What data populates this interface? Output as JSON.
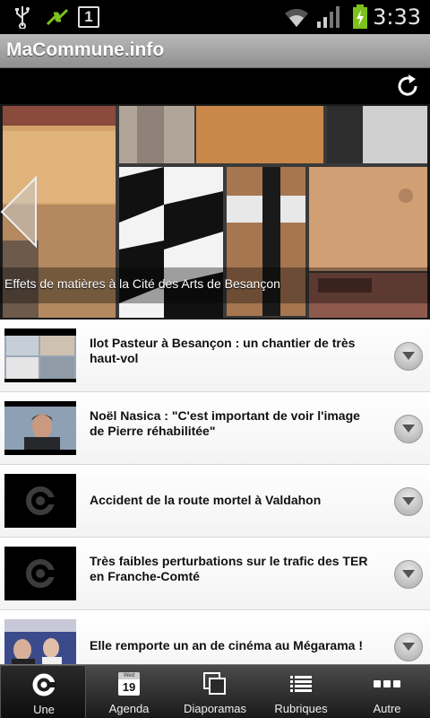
{
  "status_bar": {
    "time": "3:33",
    "icons": [
      "usb-icon",
      "sync-icon",
      "notification-1-icon",
      "wifi-icon",
      "signal-icon",
      "battery-charging-icon"
    ],
    "notification_count": "1"
  },
  "app": {
    "title": "MaCommune.info"
  },
  "toolbar": {
    "refresh_icon": "refresh-icon"
  },
  "featured": {
    "caption": "Effets de matières à la Cité des Arts de Besançon"
  },
  "articles": [
    {
      "title": "Ilot Pasteur à Besançon : un chantier de très haut-vol",
      "thumb": "photo"
    },
    {
      "title": "Noël Nasica : \"C'est important de voir l'image de Pierre réhabilitée\"",
      "thumb": "photo"
    },
    {
      "title": "Accident de la route mortel à Valdahon",
      "thumb": "logo"
    },
    {
      "title": "Très faibles perturbations sur le trafic des TER en Franche-Comté",
      "thumb": "logo"
    },
    {
      "title": "Elle remporte un an de cinéma au Mégarama !",
      "thumb": "photo"
    }
  ],
  "tabs": [
    {
      "label": "Une",
      "icon": "home-logo-icon",
      "active": true
    },
    {
      "label": "Agenda",
      "icon": "calendar-icon",
      "calendar_day": "Wed",
      "calendar_date": "19"
    },
    {
      "label": "Diaporamas",
      "icon": "slideshow-icon"
    },
    {
      "label": "Rubriques",
      "icon": "list-icon"
    },
    {
      "label": "Autre",
      "icon": "more-icon"
    }
  ],
  "colors": {
    "title_bar": "#a4a4a4",
    "status_bar": "#000000",
    "battery": "#7cc21b"
  }
}
